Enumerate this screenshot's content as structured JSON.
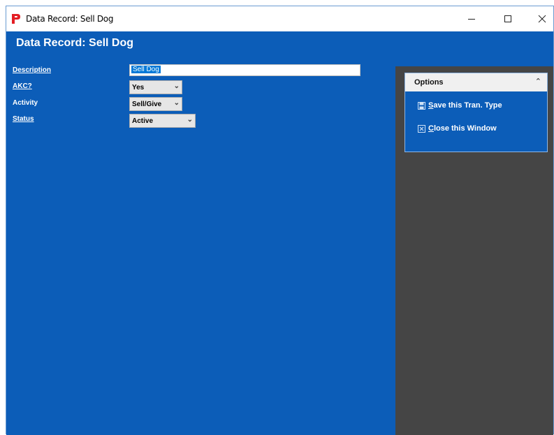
{
  "window": {
    "title": "Data Record: Sell Dog"
  },
  "header": {
    "title": "Data Record: Sell Dog"
  },
  "form": {
    "description_label": "Description",
    "description_value": "Sell Dog",
    "akc_label": "AKC?",
    "akc_value": "Yes",
    "activity_label": "Activity",
    "activity_value": "Sell/Give",
    "status_label": "Status",
    "status_value": "Active"
  },
  "options": {
    "title": "Options",
    "save_first": "S",
    "save_rest": "ave this Tran. Type",
    "close_first": "C",
    "close_rest": "lose this Window"
  },
  "colors": {
    "accent": "#0c5db8",
    "sidepanel": "#454545"
  },
  "icons": [
    "app-logo-icon",
    "minimize-icon",
    "maximize-icon",
    "close-icon",
    "collapse-icon",
    "save-icon",
    "close-window-icon",
    "chevron-down-icon"
  ]
}
